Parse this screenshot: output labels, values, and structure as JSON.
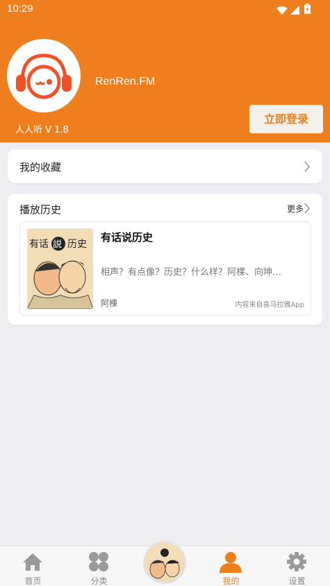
{
  "status": {
    "time": "10:29"
  },
  "profile": {
    "app_name": "RenRen.FM",
    "version": "人人听 V 1.8",
    "login_label": "立即登录"
  },
  "favorites": {
    "label": "我的收藏"
  },
  "history": {
    "title": "播放历史",
    "more_label": "更多",
    "items": [
      {
        "title": "有话说历史",
        "description": "相声？有点像？历史？什么样？阿棵、向坤…",
        "author": "阿棵",
        "source": "内容来自喜马拉雅App",
        "cover_text": [
          "有话",
          "説",
          "历史"
        ]
      }
    ]
  },
  "tabbar": {
    "tabs": [
      {
        "label": "首页",
        "icon": "home-icon"
      },
      {
        "label": "分类",
        "icon": "grid-icon"
      },
      {
        "label": "我的",
        "icon": "person-icon"
      },
      {
        "label": "设置",
        "icon": "gear-icon"
      }
    ],
    "active": "我的"
  },
  "colors": {
    "accent": "#ee7f1c",
    "background": "#eeedf2"
  }
}
